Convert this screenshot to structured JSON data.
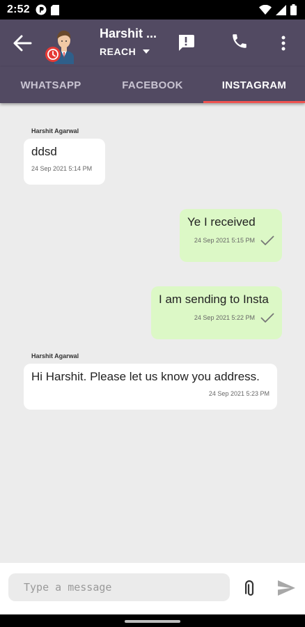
{
  "status_bar": {
    "time": "2:52"
  },
  "header": {
    "contact_name": "Harshit ...",
    "channel_label": "REACH"
  },
  "tabs": [
    {
      "label": "WHATSAPP",
      "active": false
    },
    {
      "label": "FACEBOOK",
      "active": false
    },
    {
      "label": "INSTAGRAM",
      "active": true
    }
  ],
  "messages": [
    {
      "direction": "incoming",
      "sender": "Harshit Agarwal",
      "text": "ddsd",
      "time": "24 Sep 2021 5:14 PM"
    },
    {
      "direction": "outgoing",
      "text": "Ye I received",
      "time": "24 Sep 2021 5:15 PM",
      "status": "sent"
    },
    {
      "direction": "outgoing",
      "text": "I am sending to Insta",
      "time": "24 Sep 2021 5:22 PM",
      "status": "sent"
    },
    {
      "direction": "incoming",
      "sender": "Harshit Agarwal",
      "text": "Hi Harshit. Please let us know you address.",
      "time": "24 Sep 2021 5:23 PM"
    }
  ],
  "composer": {
    "placeholder": "Type a message",
    "value": ""
  },
  "colors": {
    "app_bar": "#524a62",
    "tab_indicator": "#ef5350",
    "incoming_bubble": "#ffffff",
    "outgoing_bubble": "#dcf8c6",
    "chat_background": "#ececec"
  },
  "icons": {
    "back": "arrow-left-icon",
    "alert": "message-alert-icon",
    "call": "phone-icon",
    "more": "more-vertical-icon",
    "attach": "paperclip-icon",
    "send": "send-icon",
    "channel_dropdown": "caret-down-icon",
    "read_receipt": "check-icon"
  }
}
